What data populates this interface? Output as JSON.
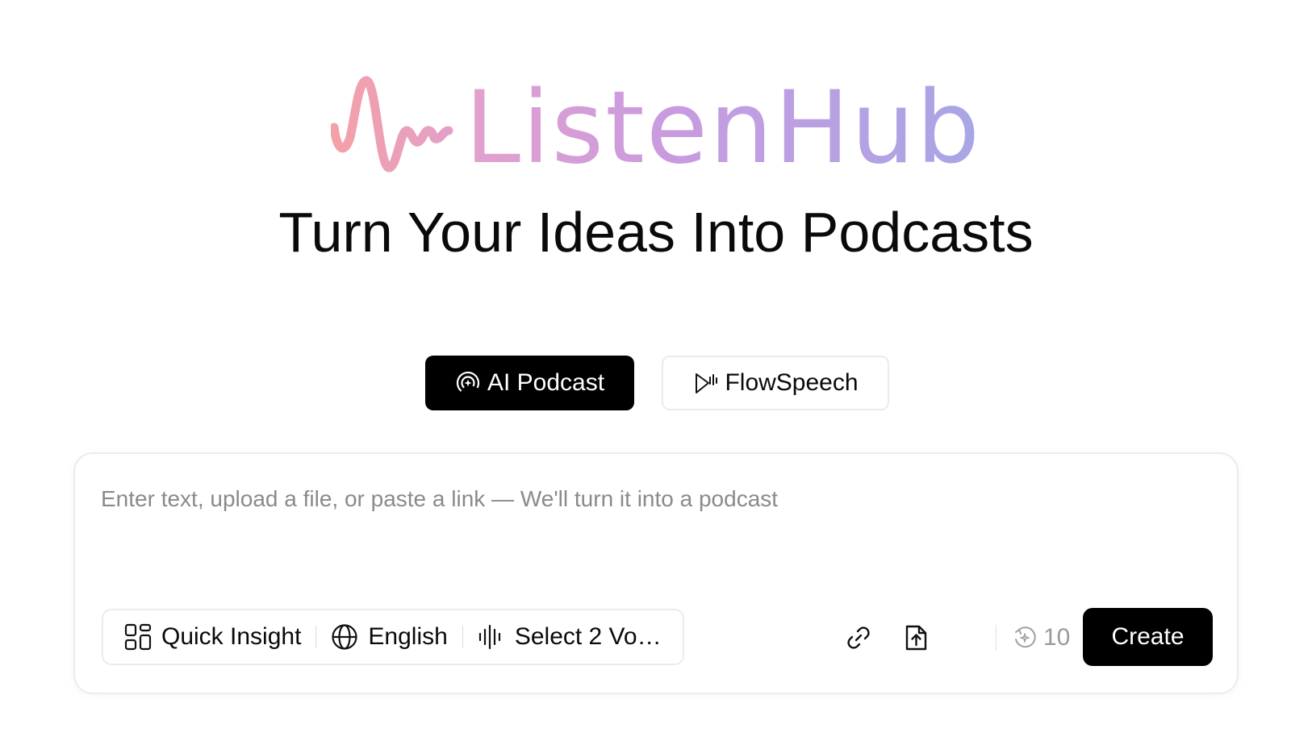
{
  "brand": {
    "name": "ListenHub",
    "logo_icon": "waveform-logo-icon",
    "gradient_colors": [
      "#f4a0a8",
      "#c89be0",
      "#a8a6e6"
    ]
  },
  "headline": "Turn Your Ideas Into Podcasts",
  "modes": [
    {
      "label": "AI Podcast",
      "icon": "podcast-icon",
      "active": true
    },
    {
      "label": "FlowSpeech",
      "icon": "flowspeech-icon",
      "active": false
    }
  ],
  "composer": {
    "placeholder": "Enter text, upload a file, or paste a link — We'll turn it into a podcast",
    "value": "",
    "options": {
      "style": {
        "label": "Quick Insight",
        "icon": "grid-icon"
      },
      "language": {
        "label": "English",
        "icon": "globe-icon"
      },
      "voices": {
        "label": "Select 2 Vo…",
        "icon": "voice-wave-icon"
      }
    },
    "actions": {
      "link_icon": "link-icon",
      "upload_icon": "upload-icon"
    },
    "credits": {
      "value": "10",
      "icon": "credits-icon"
    },
    "create_label": "Create"
  },
  "colors": {
    "primary": "#000000",
    "placeholder": "#8a8a8a",
    "border": "#ebebeb",
    "muted": "#9a9a9a"
  }
}
